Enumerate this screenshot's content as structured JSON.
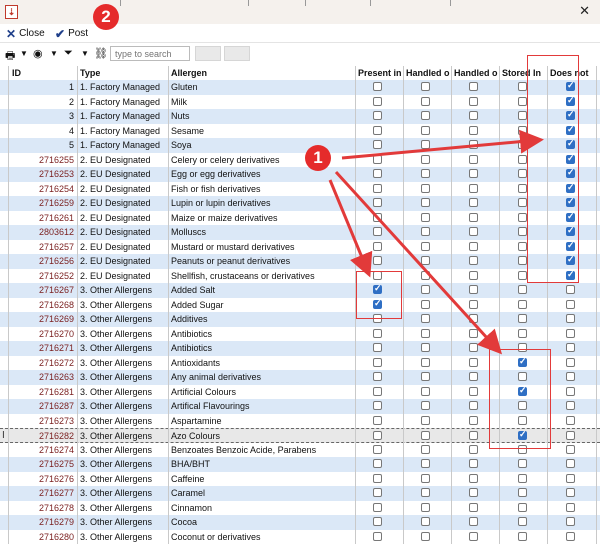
{
  "toolbar": {
    "close_label": "Close",
    "post_label": "Post"
  },
  "search": {
    "placeholder": "type to search"
  },
  "columns": [
    "ID",
    "Type",
    "Allergen",
    "Present in",
    "Handled o",
    "Handled o",
    "Stored In",
    "Does not"
  ],
  "annotations": {
    "badge1": "1",
    "badge2": "2"
  },
  "colors": {
    "row_alt": "#dbe8f7",
    "accent": "#2f6fc4",
    "annotation_red": "#e23a3a"
  },
  "rows": [
    {
      "id": "1",
      "type": "1. Factory Managed",
      "allergen": "Gluten",
      "checks": [
        false,
        false,
        false,
        false,
        true
      ]
    },
    {
      "id": "2",
      "type": "1. Factory Managed",
      "allergen": "Milk",
      "checks": [
        false,
        false,
        false,
        false,
        true
      ]
    },
    {
      "id": "3",
      "type": "1. Factory Managed",
      "allergen": "Nuts",
      "checks": [
        false,
        false,
        false,
        false,
        true
      ]
    },
    {
      "id": "4",
      "type": "1. Factory Managed",
      "allergen": "Sesame",
      "checks": [
        false,
        false,
        false,
        false,
        true
      ]
    },
    {
      "id": "5",
      "type": "1. Factory Managed",
      "allergen": "Soya",
      "checks": [
        false,
        false,
        false,
        false,
        true
      ]
    },
    {
      "id": "2716255",
      "type": "2. EU Designated",
      "allergen": "Celery or celery derivatives",
      "checks": [
        false,
        false,
        false,
        false,
        true
      ]
    },
    {
      "id": "2716253",
      "type": "2. EU Designated",
      "allergen": "Egg or egg derivatives",
      "checks": [
        false,
        false,
        false,
        false,
        true
      ]
    },
    {
      "id": "2716254",
      "type": "2. EU Designated",
      "allergen": "Fish or fish derivatives",
      "checks": [
        false,
        false,
        false,
        false,
        true
      ]
    },
    {
      "id": "2716259",
      "type": "2. EU Designated",
      "allergen": "Lupin or lupin derivatives",
      "checks": [
        false,
        false,
        false,
        false,
        true
      ]
    },
    {
      "id": "2716261",
      "type": "2. EU Designated",
      "allergen": "Maize or maize derivatives",
      "checks": [
        false,
        false,
        false,
        false,
        true
      ]
    },
    {
      "id": "2803612",
      "type": "2. EU Designated",
      "allergen": "Molluscs",
      "checks": [
        false,
        false,
        false,
        false,
        true
      ]
    },
    {
      "id": "2716257",
      "type": "2. EU Designated",
      "allergen": "Mustard or mustard derivatives",
      "checks": [
        false,
        false,
        false,
        false,
        true
      ]
    },
    {
      "id": "2716256",
      "type": "2. EU Designated",
      "allergen": "Peanuts or peanut derivatives",
      "checks": [
        false,
        false,
        false,
        false,
        true
      ]
    },
    {
      "id": "2716252",
      "type": "2. EU Designated",
      "allergen": "Shellfish, crustaceans or derivatives",
      "checks": [
        false,
        false,
        false,
        false,
        true
      ]
    },
    {
      "id": "2716267",
      "type": "3. Other Allergens",
      "allergen": "Added Salt",
      "checks": [
        true,
        false,
        false,
        false,
        false
      ]
    },
    {
      "id": "2716268",
      "type": "3. Other Allergens",
      "allergen": "Added Sugar",
      "checks": [
        true,
        false,
        false,
        false,
        false
      ]
    },
    {
      "id": "2716269",
      "type": "3. Other Allergens",
      "allergen": "Additives",
      "checks": [
        false,
        false,
        false,
        false,
        false
      ]
    },
    {
      "id": "2716270",
      "type": "3. Other Allergens",
      "allergen": "Antibiotics",
      "checks": [
        false,
        false,
        false,
        false,
        false
      ]
    },
    {
      "id": "2716271",
      "type": "3. Other Allergens",
      "allergen": "Antibiotics",
      "checks": [
        false,
        false,
        false,
        false,
        false
      ]
    },
    {
      "id": "2716272",
      "type": "3. Other Allergens",
      "allergen": "Antioxidants",
      "checks": [
        false,
        false,
        false,
        true,
        false
      ]
    },
    {
      "id": "2716263",
      "type": "3. Other Allergens",
      "allergen": "Any animal derivatives",
      "checks": [
        false,
        false,
        false,
        false,
        false
      ]
    },
    {
      "id": "2716281",
      "type": "3. Other Allergens",
      "allergen": "Artificial Colours",
      "checks": [
        false,
        false,
        false,
        true,
        false
      ]
    },
    {
      "id": "2716287",
      "type": "3. Other Allergens",
      "allergen": "Artifical Flavourings",
      "checks": [
        false,
        false,
        false,
        false,
        false
      ]
    },
    {
      "id": "2716273",
      "type": "3. Other Allergens",
      "allergen": "Aspartamine",
      "checks": [
        false,
        false,
        false,
        false,
        false
      ]
    },
    {
      "id": "2716282",
      "type": "3. Other Allergens",
      "allergen": "Azo Colours",
      "checks": [
        false,
        false,
        false,
        true,
        false
      ]
    },
    {
      "id": "2716274",
      "type": "3. Other Allergens",
      "allergen": "Benzoates Benzoic Acide, Parabens",
      "checks": [
        false,
        false,
        false,
        false,
        false
      ]
    },
    {
      "id": "2716275",
      "type": "3. Other Allergens",
      "allergen": "BHA/BHT",
      "checks": [
        false,
        false,
        false,
        false,
        false
      ]
    },
    {
      "id": "2716276",
      "type": "3. Other Allergens",
      "allergen": "Caffeine",
      "checks": [
        false,
        false,
        false,
        false,
        false
      ]
    },
    {
      "id": "2716277",
      "type": "3. Other Allergens",
      "allergen": "Caramel",
      "checks": [
        false,
        false,
        false,
        false,
        false
      ]
    },
    {
      "id": "2716278",
      "type": "3. Other Allergens",
      "allergen": "Cinnamon",
      "checks": [
        false,
        false,
        false,
        false,
        false
      ]
    },
    {
      "id": "2716279",
      "type": "3. Other Allergens",
      "allergen": "Cocoa",
      "checks": [
        false,
        false,
        false,
        false,
        false
      ]
    },
    {
      "id": "2716280",
      "type": "3. Other Allergens",
      "allergen": "Coconut or derivatives",
      "checks": [
        false,
        false,
        false,
        false,
        false
      ]
    }
  ]
}
